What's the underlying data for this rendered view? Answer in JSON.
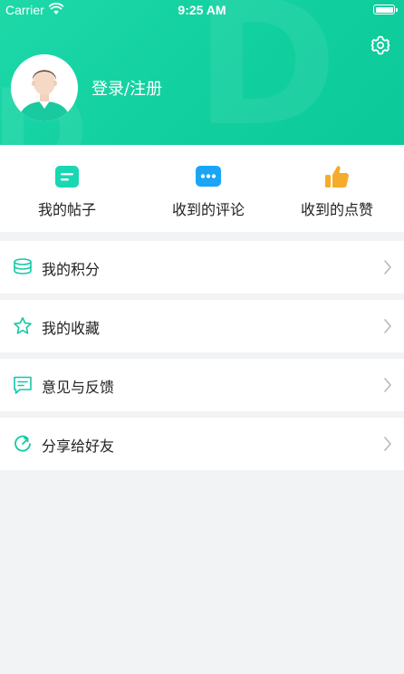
{
  "status_bar": {
    "carrier": "Carrier",
    "time": "9:25 AM"
  },
  "header": {
    "login_text": "登录/注册"
  },
  "quick_actions": [
    {
      "label": "我的帖子",
      "icon": "post-icon",
      "color": "#19d7b1"
    },
    {
      "label": "收到的评论",
      "icon": "comment-icon",
      "color": "#1aa5f7"
    },
    {
      "label": "收到的点赞",
      "icon": "thumbs-up-icon",
      "color": "#f7ab2b"
    }
  ],
  "menu": [
    {
      "label": "我的积分",
      "icon": "points-icon"
    },
    {
      "label": "我的收藏",
      "icon": "star-icon"
    },
    {
      "label": "意见与反馈",
      "icon": "feedback-icon"
    },
    {
      "label": "分享给好友",
      "icon": "share-icon"
    }
  ],
  "colors": {
    "accent": "#12d0a0",
    "icon_accent": "#14c8a4",
    "chevron": "#b8b8bd"
  }
}
